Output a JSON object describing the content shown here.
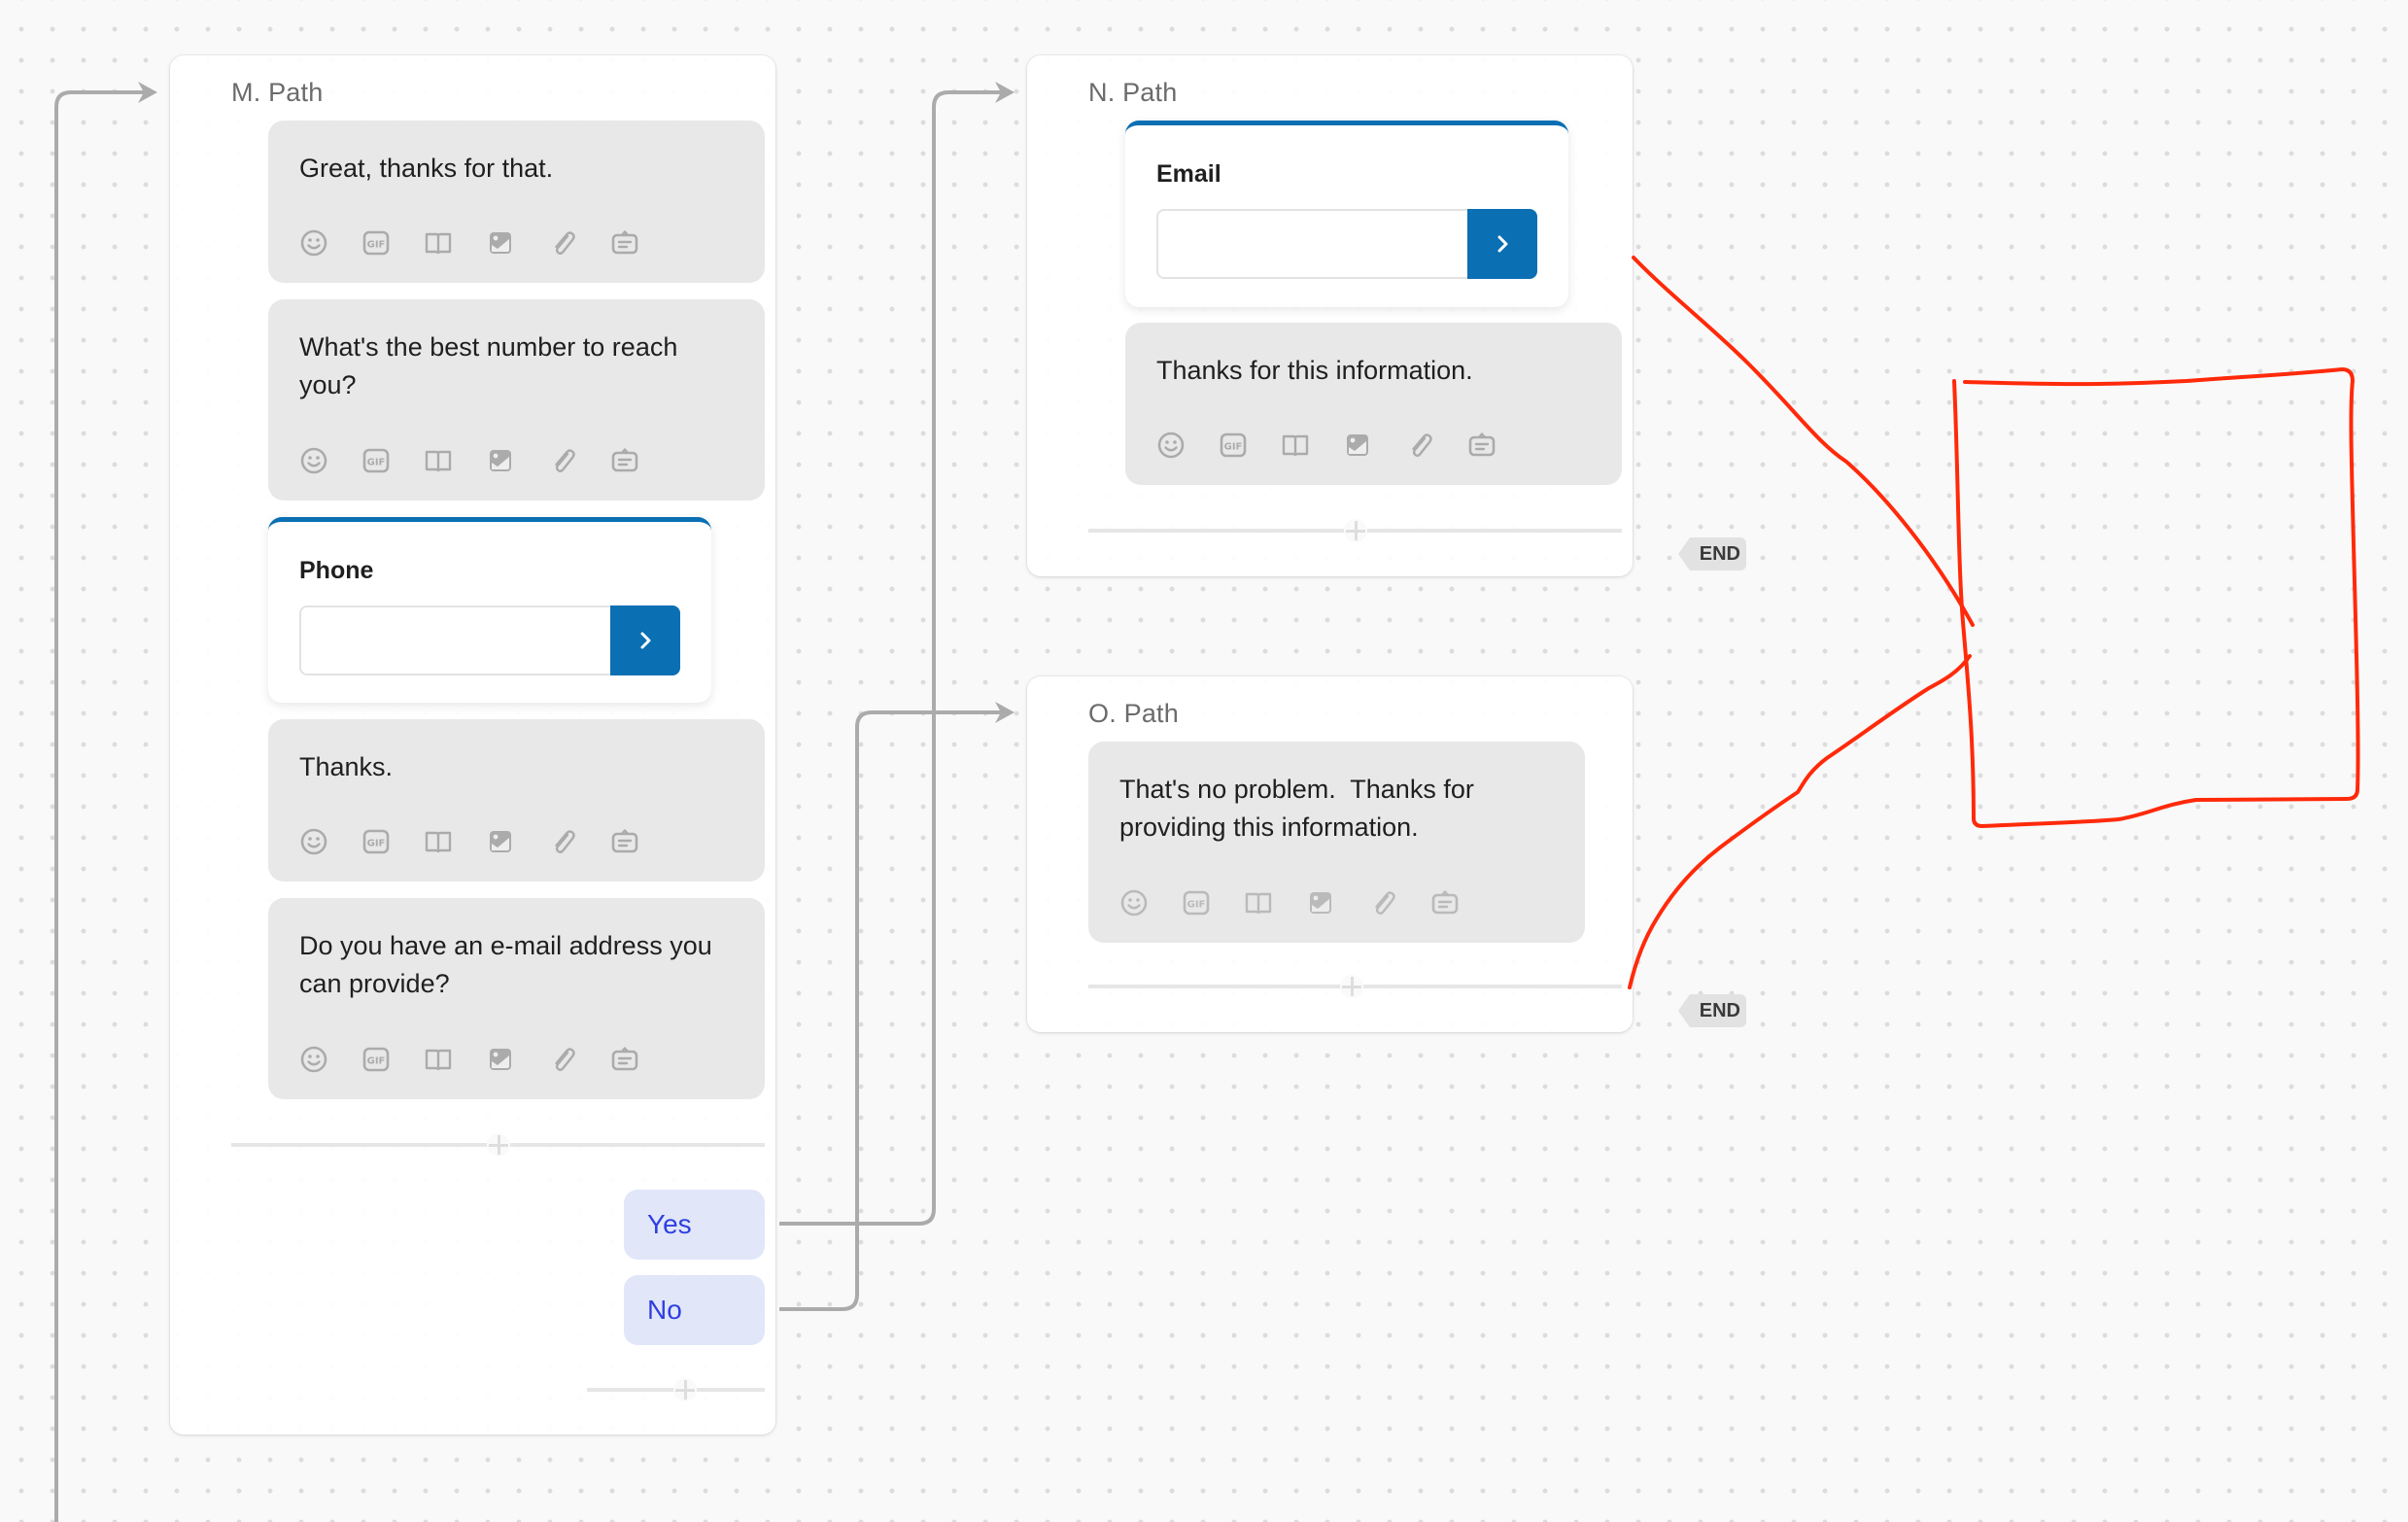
{
  "canvas": {
    "connector_color": "#ababab",
    "annotation_color": "#ff2a0a",
    "accent_color": "#0a6fb3"
  },
  "paths": {
    "m": {
      "title": "M. Path",
      "messages": [
        "Great, thanks for that.",
        "What's the best number to reach you?"
      ],
      "phone_input": {
        "label": "Phone",
        "value": "",
        "submit_icon": "chevron-right-icon"
      },
      "messages_after": [
        "Thanks.",
        "Do you have an e-mail address you can provide?"
      ],
      "choices": [
        {
          "label": "Yes",
          "target": "N. Path"
        },
        {
          "label": "No",
          "target": "O. Path"
        }
      ]
    },
    "n": {
      "title": "N. Path",
      "email_input": {
        "label": "Email",
        "value": "",
        "submit_icon": "chevron-right-icon"
      },
      "messages": [
        "Thanks for this information."
      ],
      "end_label": "END"
    },
    "o": {
      "title": "O. Path",
      "messages": [
        "That's no problem.  Thanks for providing this information."
      ],
      "end_label": "END"
    }
  },
  "message_toolbar": [
    "emoji-icon",
    "gif-icon",
    "book-icon",
    "image-icon",
    "attachment-icon",
    "note-icon"
  ]
}
